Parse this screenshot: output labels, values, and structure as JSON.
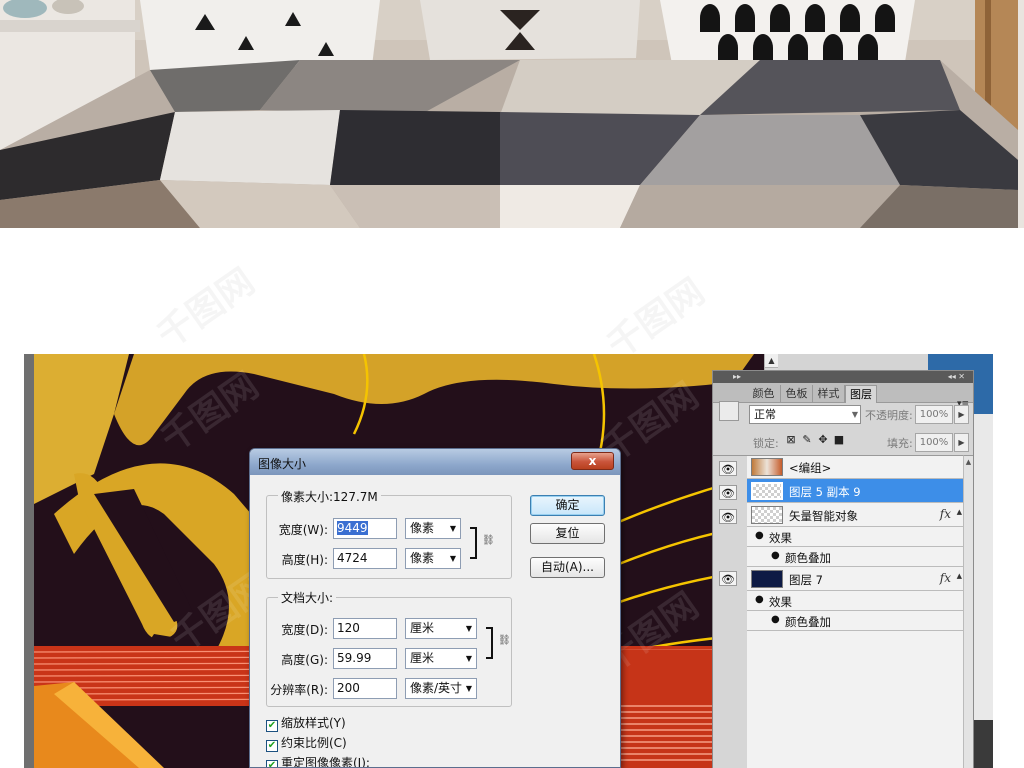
{
  "dialog": {
    "title": "图像大小",
    "close_symbol": "x",
    "pixel_group": "像素大小:127.7M",
    "pixel_width_label": "宽度(W):",
    "pixel_width_value": "9449",
    "pixel_width_unit": "像素",
    "pixel_height_label": "高度(H):",
    "pixel_height_value": "4724",
    "pixel_height_unit": "像素",
    "doc_group": "文档大小:",
    "doc_width_label": "宽度(D):",
    "doc_width_value": "120",
    "doc_width_unit": "厘米",
    "doc_height_label": "高度(G):",
    "doc_height_value": "59.99",
    "doc_height_unit": "厘米",
    "resolution_label": "分辨率(R):",
    "resolution_value": "200",
    "resolution_unit": "像素/英寸",
    "ok_label": "确定",
    "reset_label": "复位",
    "auto_label": "自动(A)...",
    "checkboxes": [
      {
        "label": "缩放样式(Y)",
        "checked": true
      },
      {
        "label": "约束比例(C)",
        "checked": true
      },
      {
        "label": "重定图像像素(I):",
        "checked": true
      }
    ]
  },
  "layers_panel": {
    "tabs": [
      "颜色",
      "色板",
      "样式",
      "图层"
    ],
    "active_tab": "图层",
    "blend_mode": "正常",
    "opacity_label": "不透明度:",
    "opacity_value": "100%",
    "lock_label": "锁定:",
    "fill_label": "填充:",
    "fill_value": "100%",
    "layers": [
      {
        "name": "<编组>",
        "selected": false
      },
      {
        "name": "图层 5 副本 9",
        "selected": true
      },
      {
        "name": "矢量智能对象",
        "selected": false,
        "fx": "fx",
        "effects_label": "效果",
        "effect": "颜色叠加"
      },
      {
        "name": "图层 7",
        "selected": false,
        "fx": "fx",
        "effects_label": "效果",
        "effect": "颜色叠加"
      }
    ]
  },
  "watermark": "千图网",
  "colors": {
    "canvas_bg": "#230f1a",
    "gold": "#d9a625",
    "selected_layer": "#3d8ee8",
    "dialog_bg": "#f0f0f0",
    "stripe_red": "#d8391e",
    "stripe_orange": "#e8891c"
  }
}
